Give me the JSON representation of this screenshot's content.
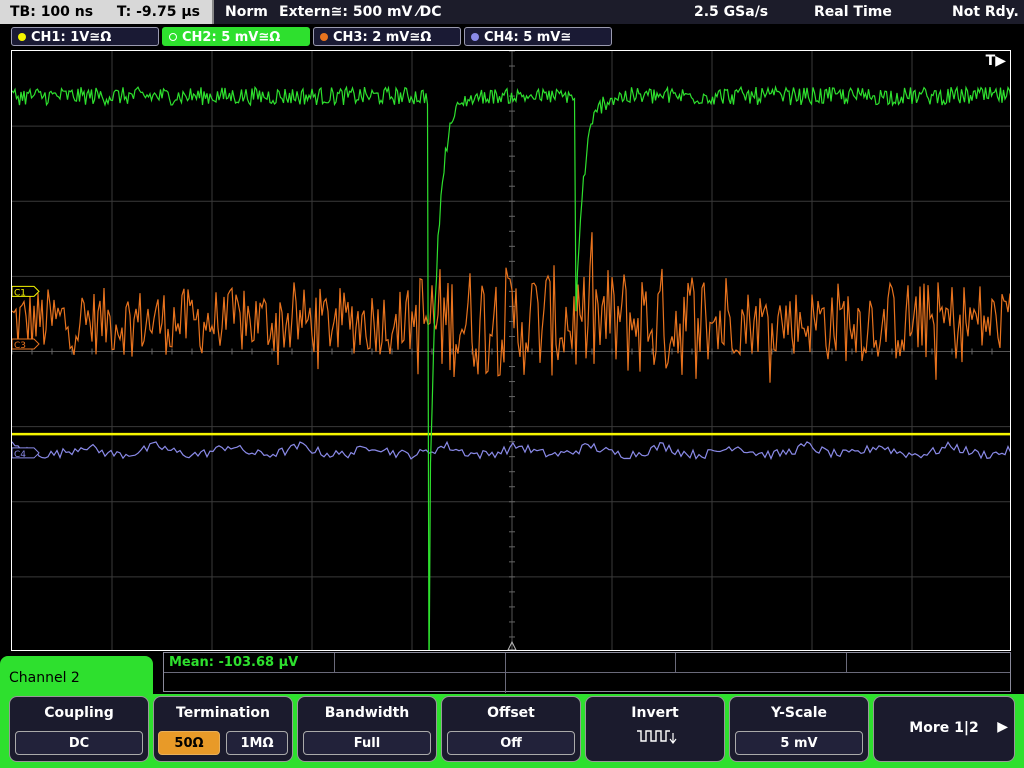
{
  "status_bar": {
    "timebase": "TB: 100 ns",
    "trigger_time": "T: -9.75 µs",
    "mode": "Norm",
    "trigger_source": "Extern≅: 500 mV ⁄DC",
    "sample_rate": "2.5 GSa/s",
    "acq_mode": "Real Time",
    "status": "Not Rdy."
  },
  "channels": [
    {
      "label": "CH1: 1V≅Ω",
      "color": "#f5f500"
    },
    {
      "label": "CH2: 5 mV≅Ω",
      "color": "#2ee02e"
    },
    {
      "label": "CH3: 2 mV≅Ω",
      "color": "#e8731e"
    },
    {
      "label": "CH4: 5 mV≅",
      "color": "#8a8ae8"
    }
  ],
  "plot": {
    "trigger_marker": "T▶",
    "markers": [
      {
        "label": "C1",
        "color": "#f5f500"
      },
      {
        "label": "C3",
        "color": "#e8731e"
      },
      {
        "label": "C4",
        "color": "#8a8ae8"
      }
    ]
  },
  "measurement": {
    "label": "Mean: -103.68 µV"
  },
  "menu": {
    "title": "Channel 2",
    "softkeys": [
      {
        "title": "Coupling",
        "value": "DC"
      },
      {
        "title": "Termination",
        "options": [
          "50Ω",
          "1MΩ"
        ],
        "selected": "50Ω"
      },
      {
        "title": "Bandwidth",
        "value": "Full"
      },
      {
        "title": "Offset",
        "value": "Off"
      },
      {
        "title": "Invert",
        "icon": "inverted-square-wave-icon"
      },
      {
        "title": "Y-Scale",
        "value": "5 mV"
      }
    ],
    "more": "More 1|2"
  },
  "chart_data": {
    "type": "line",
    "grid": true,
    "x_divisions": 10,
    "y_divisions": 8,
    "series": [
      {
        "name": "CH1",
        "color": "#f5f500",
        "shape": "flat line at ~-1.1 div below center",
        "level_div": 1.1
      },
      {
        "name": "CH2",
        "color": "#2ee02e",
        "shape": "baseline at +3.4 div with two negative pulses (~-3.8 div and ~-1.6 div) at x≈4.2 div and x≈5.65 div with exponential recovery",
        "baseline_div": 3.4
      },
      {
        "name": "CH3",
        "color": "#e8731e",
        "shape": "noisy signal around +0.6 div with ±1 div spikes, larger around x 4–7 div",
        "level_div": 0.6
      },
      {
        "name": "CH4",
        "color": "#8a8ae8",
        "shape": "slightly noisy level near -1.2 div",
        "level_div": 1.2
      }
    ]
  }
}
